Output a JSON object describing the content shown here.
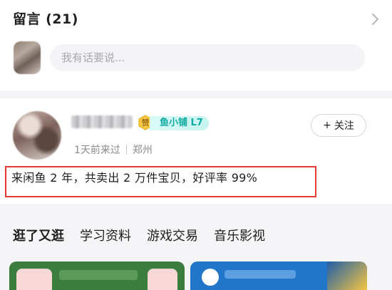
{
  "comments": {
    "title": "留言 (21)",
    "input_placeholder": "我有话要说..."
  },
  "seller": {
    "badge_zan": "赞",
    "level_badge": "鱼小铺 L7",
    "follow_label": "关注",
    "last_seen": "1天前来过",
    "location": "郑州",
    "stats": "来闲鱼 2 年，共卖出 2 万件宝贝，好评率 99%"
  },
  "tabs": [
    {
      "label": "逛了又逛",
      "active": true
    },
    {
      "label": "学习资料",
      "active": false
    },
    {
      "label": "游戏交易",
      "active": false
    },
    {
      "label": "音乐影视",
      "active": false
    }
  ],
  "colors": {
    "accent_yellow": "#ffe14d",
    "level_teal": "#0ea9a1",
    "highlight_red": "#e53935"
  }
}
